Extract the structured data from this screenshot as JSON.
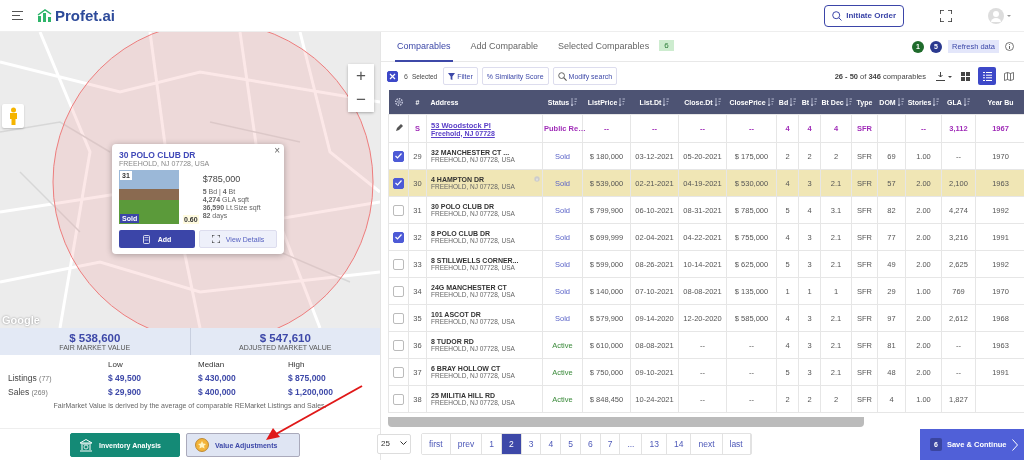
{
  "header": {
    "logo": "Profet.ai",
    "initiate_order": "Initiate Order"
  },
  "map": {
    "zoom_in": "+",
    "zoom_out": "−",
    "attribution": "Google",
    "popup": {
      "close": "×",
      "title": "30 POLO CLUB DR",
      "address": "FREEHOLD, NJ 07728, USA",
      "number": "31",
      "status": "Sold",
      "score": "0.60",
      "price": "$785,000",
      "details": [
        "**5** Bd | **4** Bt",
        "**4,274** GLA sqft",
        "**36,590** Lt.Size sqft",
        "**82** days"
      ],
      "add": "Add",
      "view": "View Details"
    }
  },
  "values": [
    {
      "amount": "$ 538,600",
      "label": "FAIR MARKET VALUE"
    },
    {
      "amount": "$ 547,610",
      "label": "ADJUSTED MARKET VALUE"
    }
  ],
  "stats": {
    "columns": [
      "Low",
      "Median",
      "High"
    ],
    "rows": [
      {
        "label": "Listings",
        "count": "(77)",
        "values": [
          "$ 49,500",
          "$ 430,000",
          "$ 875,000"
        ]
      },
      {
        "label": "Sales",
        "count": "(269)",
        "values": [
          "$ 29,900",
          "$ 400,000",
          "$ 1,200,000"
        ]
      }
    ],
    "note": "FairMarket Value is derived by the average of comparable REMarket Listings and Sales."
  },
  "actions": [
    {
      "label": "Inventory Analysis",
      "kind": "primary"
    },
    {
      "label": "Value Adjustments",
      "kind": "secondary"
    }
  ],
  "tabs": [
    {
      "label": "Comparables",
      "selected": true
    },
    {
      "label": "Add Comparable",
      "selected": false
    },
    {
      "label": "Selected Comparables",
      "selected": false,
      "badge": "6"
    }
  ],
  "tab_badges": [
    {
      "text": "1",
      "color": "#1f6b2c"
    },
    {
      "text": "5",
      "color": "#2b3a8f"
    }
  ],
  "refresh": "Refresh data",
  "toolbar": {
    "selection_checked": true,
    "selected_count": "6",
    "selected_label": "Selected",
    "buttons": [
      {
        "kind": "filter",
        "label": "Filter"
      },
      {
        "kind": "similarity",
        "label": "% Similarity Score"
      },
      {
        "kind": "search",
        "label": "Modify search"
      }
    ],
    "range": "**26 - 50** of **346** comparables",
    "views": [
      {
        "kind": "grid",
        "selected": false
      },
      {
        "kind": "list",
        "selected": true
      },
      {
        "kind": "map",
        "selected": false
      }
    ]
  },
  "table": {
    "columns": [
      {
        "label": "#",
        "sortable": false
      },
      {
        "label": "Address",
        "sortable": false
      },
      {
        "label": "Status",
        "sortable": true
      },
      {
        "label": "ListPrice",
        "sortable": true
      },
      {
        "label": "List.Dt",
        "sortable": true
      },
      {
        "label": "Close.Dt",
        "sortable": true
      },
      {
        "label": "ClosePrice",
        "sortable": true
      },
      {
        "label": "Bd",
        "sortable": true
      },
      {
        "label": "Bt",
        "sortable": true
      },
      {
        "label": "Bt Dec",
        "sortable": true
      },
      {
        "label": "Type",
        "sortable": false
      },
      {
        "label": "DOM",
        "sortable": true
      },
      {
        "label": "Stories",
        "sortable": true
      },
      {
        "label": "GLA",
        "sortable": true
      },
      {
        "label": "Year Bu",
        "sortable": false
      }
    ],
    "subject": {
      "cells": [
        "S",
        {
          "name": "53 Woodstock Pl",
          "city": "Freehold, NJ 07728"
        },
        "Public Re…",
        "--",
        "--",
        "--",
        "--",
        "4",
        "4",
        "4",
        "SFR",
        null,
        "--",
        "3,112",
        "1967"
      ]
    },
    "rows": [
      {
        "checked": true,
        "highlighted": false,
        "info": false,
        "kind": "sold",
        "cells": [
          "29",
          {
            "name": "32 MANCHESTER CT ...",
            "city": "FREEHOLD, NJ 07728, USA"
          },
          "Sold",
          "$ 180,000",
          "03-12-2021",
          "05-20-2021",
          "$ 175,000",
          "2",
          "2",
          "2",
          "SFR",
          "69",
          "1.00",
          "--",
          "1970"
        ]
      },
      {
        "checked": true,
        "highlighted": true,
        "info": true,
        "kind": "sold",
        "cells": [
          "30",
          {
            "name": "4 HAMPTON DR",
            "city": "FREEHOLD, NJ 07728, USA"
          },
          "Sold",
          "$ 539,000",
          "02-21-2021",
          "04-19-2021",
          "$ 530,000",
          "4",
          "3",
          "2.1",
          "SFR",
          "57",
          "2.00",
          "2,100",
          "1963"
        ]
      },
      {
        "checked": false,
        "highlighted": false,
        "info": false,
        "kind": "sold",
        "cells": [
          "31",
          {
            "name": "30 POLO CLUB DR",
            "city": "FREEHOLD, NJ 07728, USA"
          },
          "Sold",
          "$ 799,900",
          "06-10-2021",
          "08-31-2021",
          "$ 785,000",
          "5",
          "4",
          "3.1",
          "SFR",
          "82",
          "2.00",
          "4,274",
          "1992"
        ]
      },
      {
        "checked": true,
        "highlighted": false,
        "info": false,
        "kind": "sold",
        "cells": [
          "32",
          {
            "name": "8 POLO CLUB DR",
            "city": "FREEHOLD, NJ 07728, USA"
          },
          "Sold",
          "$ 699,999",
          "02-04-2021",
          "04-22-2021",
          "$ 755,000",
          "4",
          "3",
          "2.1",
          "SFR",
          "77",
          "2.00",
          "3,216",
          "1991"
        ]
      },
      {
        "checked": false,
        "highlighted": false,
        "info": false,
        "kind": "sold",
        "cells": [
          "33",
          {
            "name": "8 STILLWELLS CORNER...",
            "city": "FREEHOLD, NJ 07728, USA"
          },
          "Sold",
          "$ 599,000",
          "08-26-2021",
          "10-14-2021",
          "$ 625,000",
          "5",
          "3",
          "2.1",
          "SFR",
          "49",
          "2.00",
          "2,625",
          "1992"
        ]
      },
      {
        "checked": false,
        "highlighted": false,
        "info": false,
        "kind": "sold",
        "cells": [
          "34",
          {
            "name": "24G MANCHESTER CT",
            "city": "FREEHOLD, NJ 07728, USA"
          },
          "Sold",
          "$ 140,000",
          "07-10-2021",
          "08-08-2021",
          "$ 135,000",
          "1",
          "1",
          "1",
          "SFR",
          "29",
          "1.00",
          "769",
          "1970"
        ]
      },
      {
        "checked": false,
        "highlighted": false,
        "info": false,
        "kind": "sold",
        "cells": [
          "35",
          {
            "name": "101 ASCOT DR",
            "city": "FREEHOLD, NJ 07728, USA"
          },
          "Sold",
          "$ 579,900",
          "09-14-2020",
          "12-20-2020",
          "$ 585,000",
          "4",
          "3",
          "2.1",
          "SFR",
          "97",
          "2.00",
          "2,612",
          "1968"
        ]
      },
      {
        "checked": false,
        "highlighted": false,
        "info": false,
        "kind": "active",
        "cells": [
          "36",
          {
            "name": "8 TUDOR RD",
            "city": "FREEHOLD, NJ 07728, USA"
          },
          "Active",
          "$ 610,000",
          "08-08-2021",
          "--",
          "--",
          "4",
          "3",
          "2.1",
          "SFR",
          "81",
          "2.00",
          "--",
          "1963"
        ]
      },
      {
        "checked": false,
        "highlighted": false,
        "info": false,
        "kind": "active",
        "cells": [
          "37",
          {
            "name": "6 BRAY HOLLOW CT",
            "city": "FREEHOLD, NJ 07728, USA"
          },
          "Active",
          "$ 750,000",
          "09-10-2021",
          "--",
          "--",
          "5",
          "3",
          "2.1",
          "SFR",
          "48",
          "2.00",
          "--",
          "1991"
        ]
      },
      {
        "checked": false,
        "highlighted": false,
        "info": false,
        "kind": "active",
        "cells": [
          "38",
          {
            "name": "25 MILITIA HILL RD",
            "city": "FREEHOLD, NJ 07728, USA"
          },
          "Active",
          "$ 848,450",
          "10-24-2021",
          "--",
          "--",
          "2",
          "2",
          "2",
          "SFR",
          "4",
          "1.00",
          "1,827",
          null
        ]
      }
    ]
  },
  "pagination": {
    "page_size": "25",
    "pages": [
      {
        "label": "first",
        "selected": false
      },
      {
        "label": "prev",
        "selected": false
      },
      {
        "label": "1",
        "selected": false
      },
      {
        "label": "2",
        "selected": true
      },
      {
        "label": "3",
        "selected": false
      },
      {
        "label": "4",
        "selected": false
      },
      {
        "label": "5",
        "selected": false
      },
      {
        "label": "6",
        "selected": false
      },
      {
        "label": "7",
        "selected": false
      },
      {
        "label": "...",
        "selected": false
      },
      {
        "label": "13",
        "selected": false
      },
      {
        "label": "14",
        "selected": false
      },
      {
        "label": "next",
        "selected": false
      },
      {
        "label": "last",
        "selected": false
      }
    ]
  },
  "save": {
    "count": "6",
    "label": "Save & Continue"
  }
}
